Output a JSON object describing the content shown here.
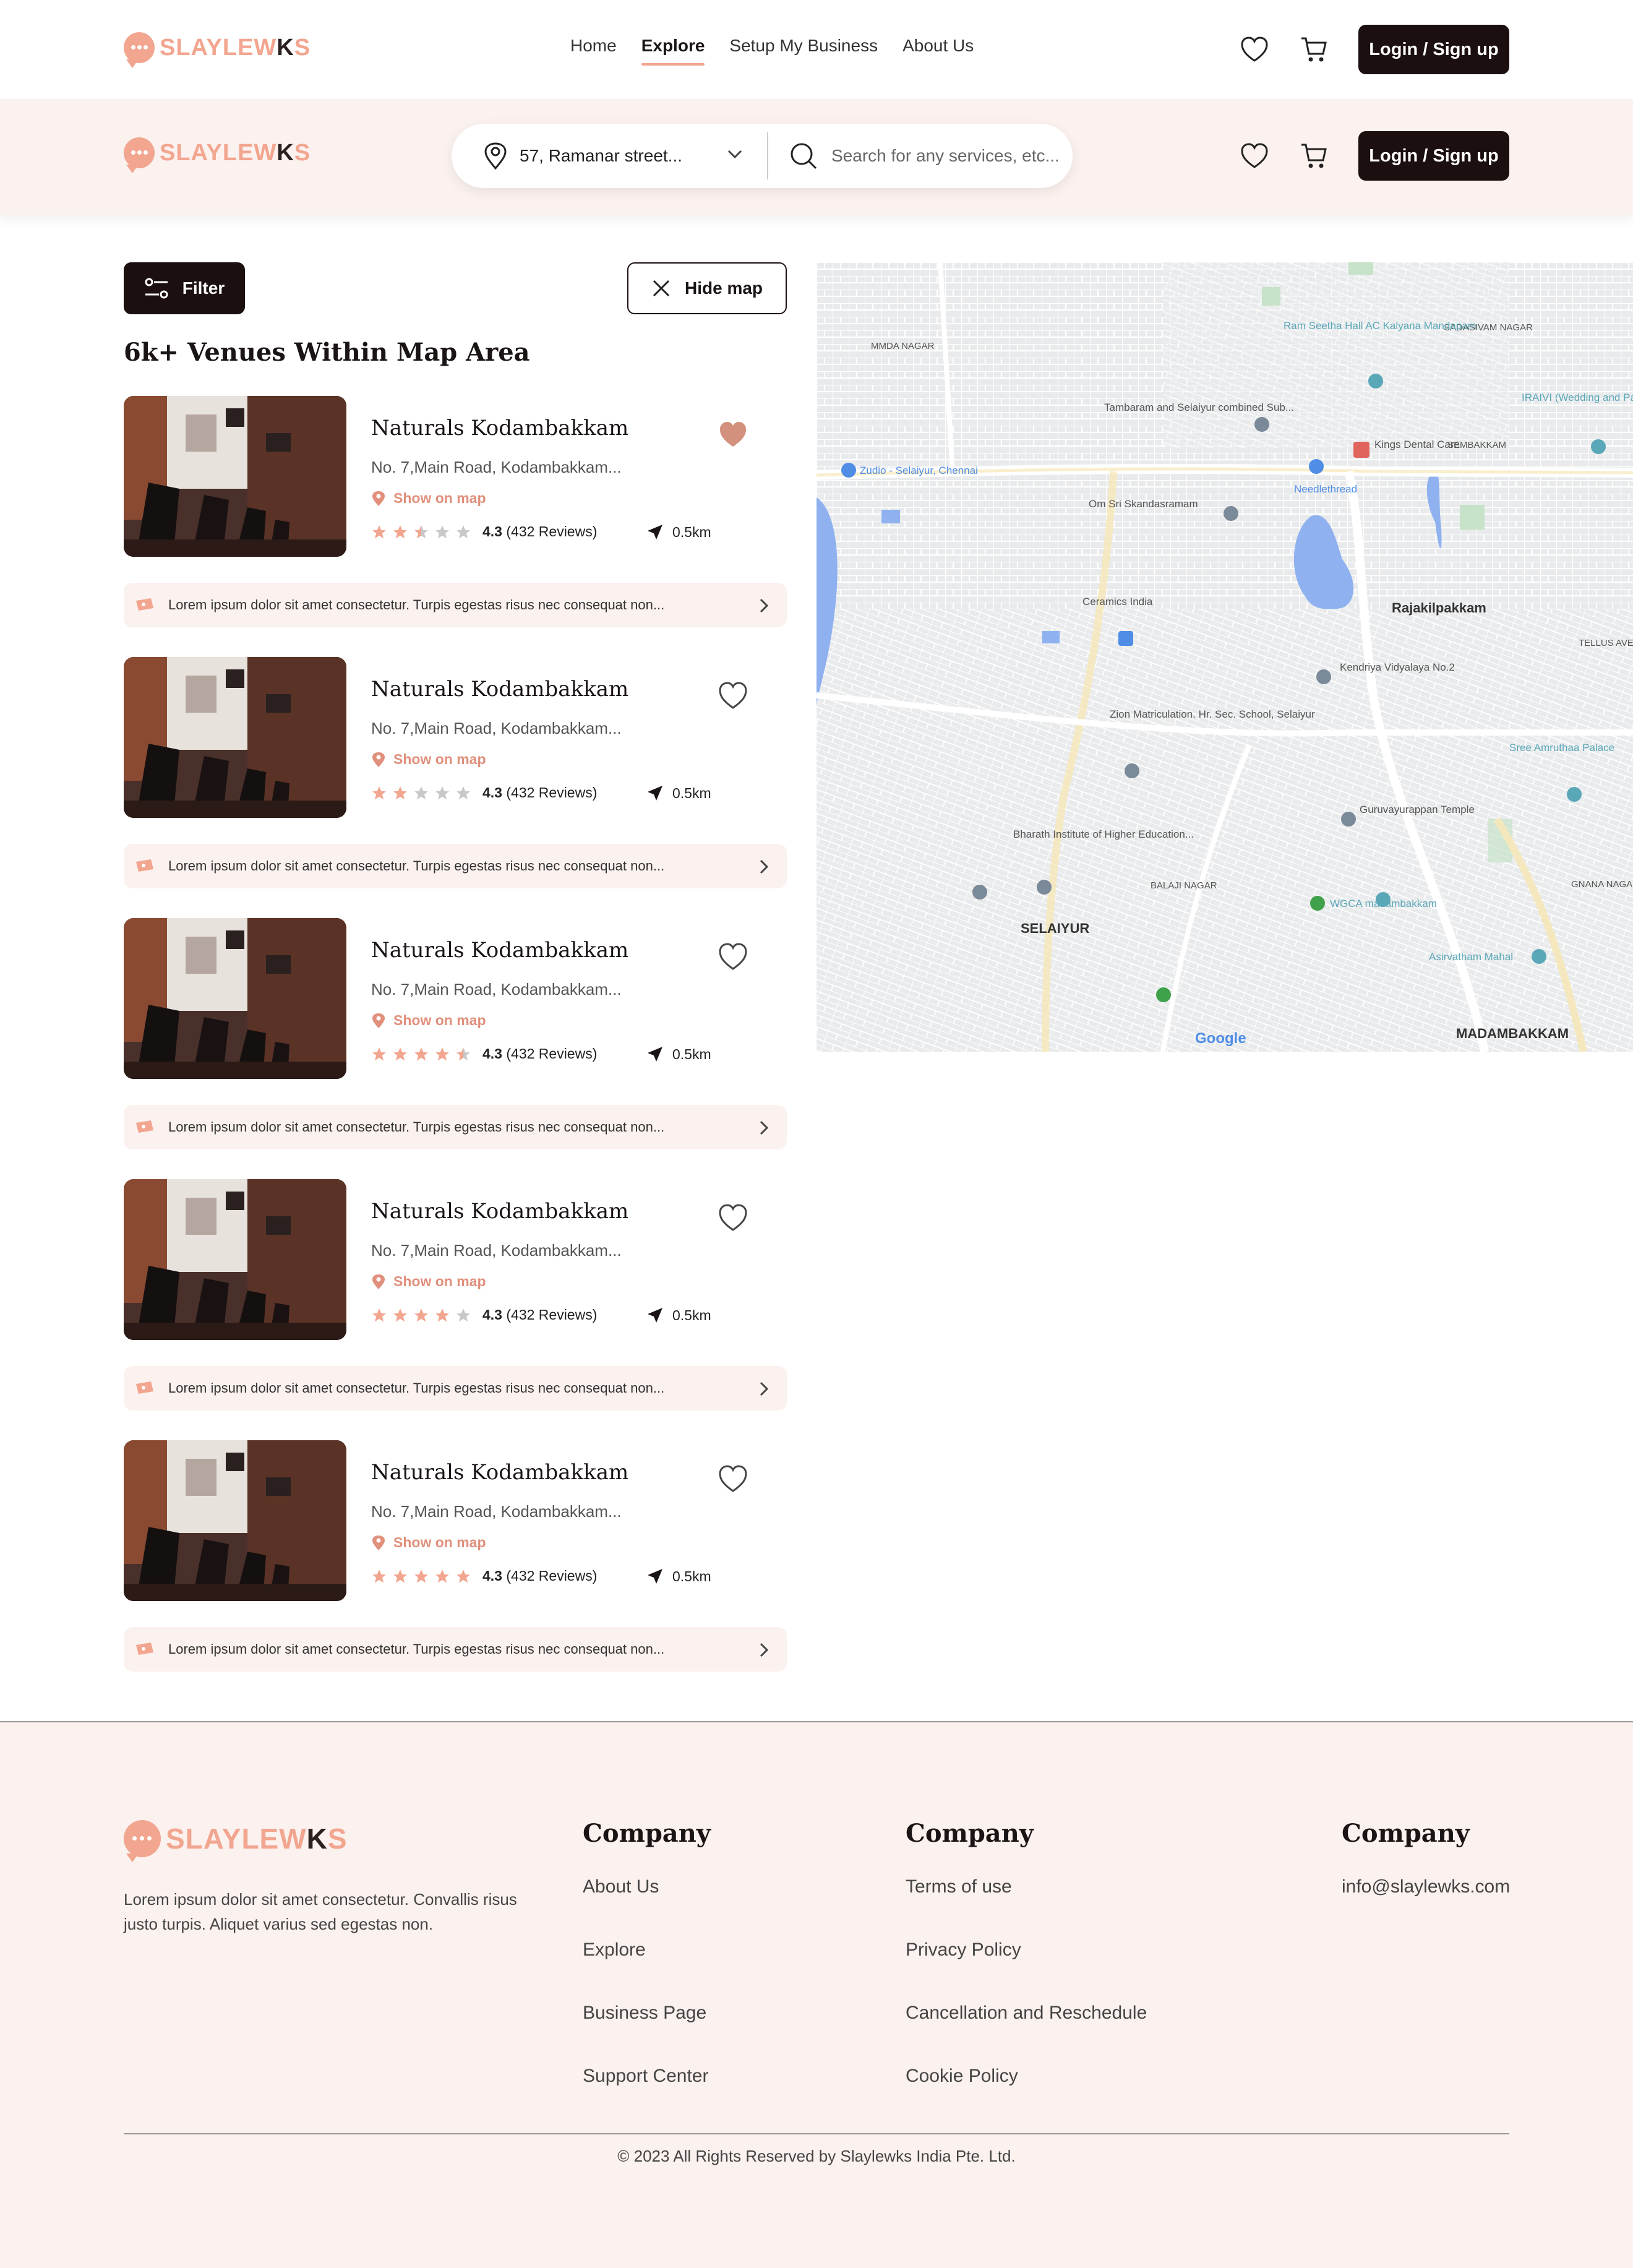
{
  "brand": {
    "name_pre": "SLAYLEW",
    "name_k": "K",
    "name_post": "S"
  },
  "nav": [
    {
      "label": "Home"
    },
    {
      "label": "Explore",
      "active": true
    },
    {
      "label": "Setup My Business"
    },
    {
      "label": "About Us"
    }
  ],
  "header": {
    "login_label": "Login / Sign up",
    "wishlist_icon": "heart-icon",
    "cart_icon": "cart-icon"
  },
  "search": {
    "location": "57, Ramanar street...",
    "placeholder": "Search for any services, etc..."
  },
  "toolbar": {
    "filter_label": "Filter",
    "hide_map_label": "Hide map"
  },
  "results": {
    "title": "6k+ Venues Within Map Area"
  },
  "venues": [
    {
      "name": "Naturals Kodambakkam",
      "address": "No. 7,Main Road, Kodambakkam...",
      "show_on_map": "Show on map",
      "rating": "4.3",
      "reviews": "(432 Reviews)",
      "stars": 2.5,
      "distance": "0.5km",
      "favorited": true,
      "promo": "Lorem ipsum dolor sit amet consectetur. Turpis egestas risus nec consequat non..."
    },
    {
      "name": "Naturals Kodambakkam",
      "address": "No. 7,Main Road, Kodambakkam...",
      "show_on_map": "Show on map",
      "rating": "4.3",
      "reviews": "(432 Reviews)",
      "stars": 2,
      "distance": "0.5km",
      "favorited": false,
      "promo": "Lorem ipsum dolor sit amet consectetur. Turpis egestas risus nec consequat non..."
    },
    {
      "name": "Naturals Kodambakkam",
      "address": "No. 7,Main Road, Kodambakkam...",
      "show_on_map": "Show on map",
      "rating": "4.3",
      "reviews": "(432 Reviews)",
      "stars": 4.5,
      "distance": "0.5km",
      "favorited": false,
      "promo": "Lorem ipsum dolor sit amet consectetur. Turpis egestas risus nec consequat non..."
    },
    {
      "name": "Naturals Kodambakkam",
      "address": "No. 7,Main Road, Kodambakkam...",
      "show_on_map": "Show on map",
      "rating": "4.3",
      "reviews": "(432 Reviews)",
      "stars": 4,
      "distance": "0.5km",
      "favorited": false,
      "promo": "Lorem ipsum dolor sit amet consectetur. Turpis egestas risus nec consequat non..."
    },
    {
      "name": "Naturals Kodambakkam",
      "address": "No. 7,Main Road, Kodambakkam...",
      "show_on_map": "Show on map",
      "rating": "4.3",
      "reviews": "(432 Reviews)",
      "stars": 5,
      "distance": "0.5km",
      "favorited": false,
      "promo": "Lorem ipsum dolor sit amet consectetur. Turpis egestas risus nec consequat non..."
    }
  ],
  "map": {
    "labels": [
      "MMDA NAGAR",
      "Ram Seetha Hall AC Kalyana Mandapam",
      "SADASIVAM NAGAR",
      "Tambaram and Selaiyur combined Sub...",
      "IRAIVI (Wedding and Partywear Store)",
      "Kings Dental Care",
      "SEMBAKKAM",
      "Zudio - Selaiyur, Chennai",
      "Om Sri Skandasramam",
      "Needlethread",
      "Ceramics India",
      "Rajakilpakkam",
      "Kendriya Vidyalaya No.2",
      "TELLUS AVE",
      "Zion Matriculation. Hr. Sec. School, Selaiyur",
      "Sree Amruthaa Palace",
      "Bharath Institute of Higher Education...",
      "Guruvayurappan Temple",
      "BALAJI NAGAR",
      "WGCA madambakkam",
      "GNANA NAGAR",
      "SELAIYUR",
      "Asirvatham Mahal",
      "MADAMBAKKAM",
      "Google"
    ]
  },
  "footer": {
    "description": "Lorem ipsum dolor sit amet consectetur. Convallis risus justo turpis. Aliquet varius sed egestas non.",
    "col1": {
      "title": "Company",
      "links": [
        "About Us",
        "Explore",
        "Business Page",
        "Support Center"
      ]
    },
    "col2": {
      "title": "Company",
      "links": [
        "Terms of use",
        "Privacy Policy",
        "Cancellation and Reschedule",
        "Cookie Policy"
      ]
    },
    "col3": {
      "title": "Company",
      "links": [
        "info@slaylewks.com"
      ]
    },
    "copyright": "© 2023 All Rights Reserved by Slaylewks India Pte. Ltd."
  },
  "colors": {
    "accent": "#f2a58f",
    "dark": "#1c0f0f",
    "tint": "#fbf1ee"
  }
}
